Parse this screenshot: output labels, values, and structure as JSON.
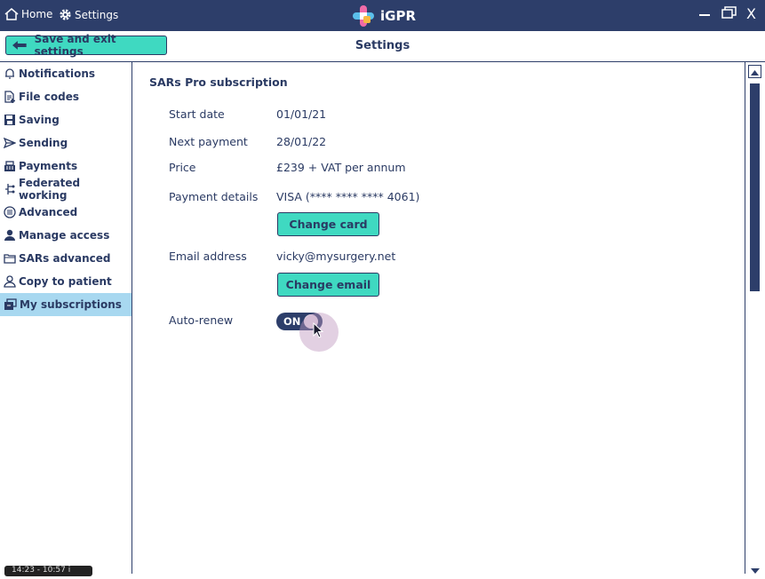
{
  "titlebar": {
    "home_label": "Home",
    "settings_label": "Settings",
    "app_title": "iGPR",
    "minimize": "—",
    "close": "X"
  },
  "toolbar": {
    "save_label": "Save and exit settings",
    "page_title": "Settings"
  },
  "sidebar": {
    "items": [
      {
        "label": "Notifications",
        "icon": "bell-icon"
      },
      {
        "label": "File codes",
        "icon": "file-add-icon"
      },
      {
        "label": "Saving",
        "icon": "floppy-icon"
      },
      {
        "label": "Sending",
        "icon": "send-icon"
      },
      {
        "label": "Payments",
        "icon": "cash-register-icon"
      },
      {
        "label": "Federated working",
        "icon": "federated-icon"
      },
      {
        "label": "Advanced",
        "icon": "advanced-icon"
      },
      {
        "label": "Manage access",
        "icon": "user-icon"
      },
      {
        "label": "SARs advanced",
        "icon": "folder-icon"
      },
      {
        "label": "Copy to patient",
        "icon": "person-outline-icon"
      },
      {
        "label": "My subscriptions",
        "icon": "subscriptions-icon",
        "active": true
      }
    ]
  },
  "subscription": {
    "title": "SARs Pro subscription",
    "start_date_label": "Start date",
    "start_date": "01/01/21",
    "next_payment_label": "Next payment",
    "next_payment": "28/01/22",
    "price_label": "Price",
    "price": "£239 + VAT per annum",
    "payment_details_label": "Payment details",
    "payment_details": "VISA (**** **** **** 4061)",
    "change_card_label": "Change card",
    "email_label": "Email address",
    "email": "vicky@mysurgery.net",
    "change_email_label": "Change email",
    "auto_renew_label": "Auto-renew",
    "auto_renew_state": "ON"
  },
  "statusbar": {
    "tooltip": "14:23 - 10:57 i"
  },
  "colors": {
    "navy": "#2d3e6a",
    "accent": "#3fd9c1",
    "active_nav": "#a8d8f0"
  }
}
